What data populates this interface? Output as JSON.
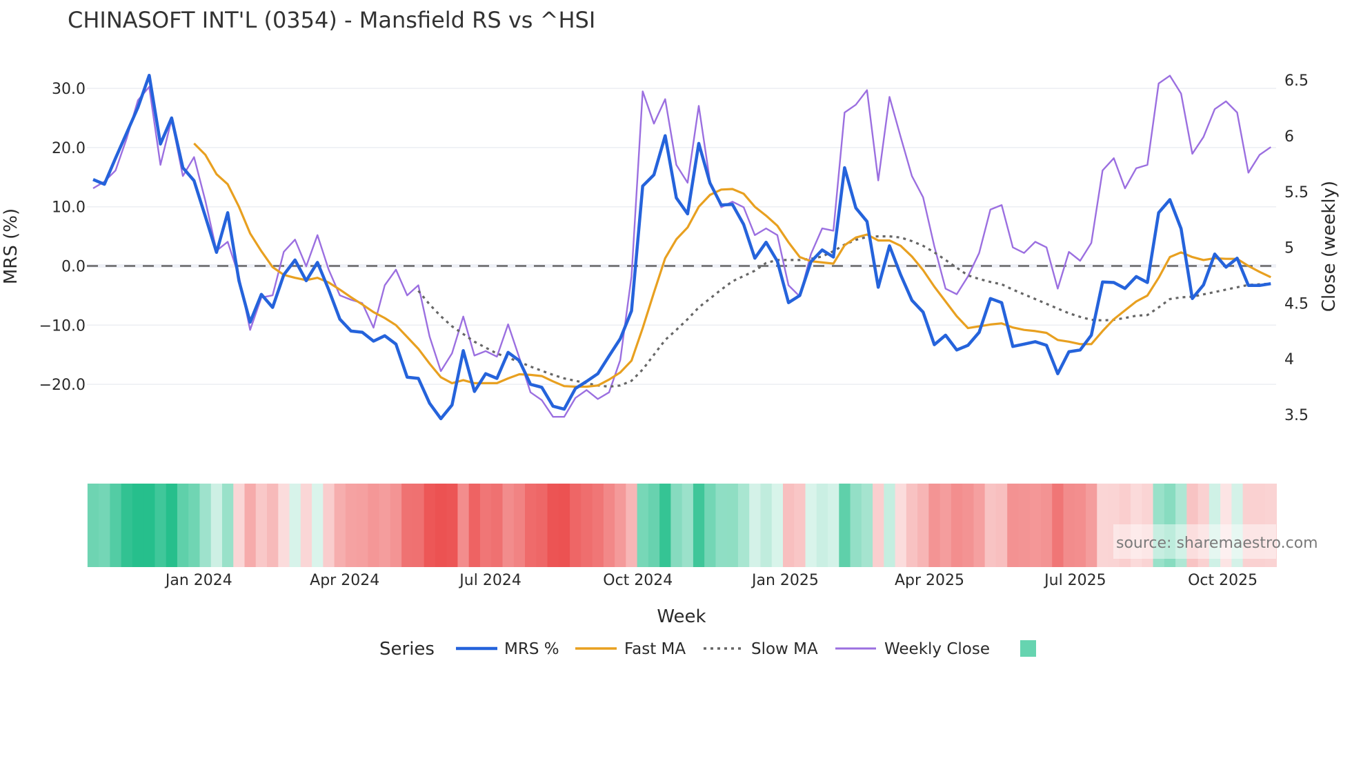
{
  "chart_data": {
    "type": "line",
    "title": "CHINASOFT INT'L (0354) - Mansfield RS vs ^HSI",
    "xlabel": "Week",
    "ylabel": "MRS (%)",
    "y2label": "Close (weekly)",
    "x_start": "2023-10-27",
    "x_step_days": 7,
    "ylim": [
      -27,
      33
    ],
    "y2lim": [
      3.5,
      6.5
    ],
    "yticks": [
      {
        "v": 30,
        "label": "30.0"
      },
      {
        "v": 20,
        "label": "20.0"
      },
      {
        "v": 10,
        "label": "10.0"
      },
      {
        "v": 0,
        "label": "0.0"
      },
      {
        "v": -10,
        "label": "−10.0"
      },
      {
        "v": -20,
        "label": "−20.0"
      }
    ],
    "y2ticks": [
      {
        "v": 6.5,
        "label": "6.5"
      },
      {
        "v": 6,
        "label": "6"
      },
      {
        "v": 5.5,
        "label": "5.5"
      },
      {
        "v": 5,
        "label": "5"
      },
      {
        "v": 4.5,
        "label": "4.5"
      },
      {
        "v": 4,
        "label": "4"
      },
      {
        "v": 3.5,
        "label": "3.5"
      }
    ],
    "xticks": [
      {
        "date": "2024-01-01",
        "label": "Jan 2024"
      },
      {
        "date": "2024-04-01",
        "label": "Apr 2024"
      },
      {
        "date": "2024-07-01",
        "label": "Jul 2024"
      },
      {
        "date": "2024-10-01",
        "label": "Oct 2024"
      },
      {
        "date": "2025-01-01",
        "label": "Jan 2025"
      },
      {
        "date": "2025-04-01",
        "label": "Apr 2025"
      },
      {
        "date": "2025-07-01",
        "label": "Jul 2025"
      },
      {
        "date": "2025-10-01",
        "label": "Oct 2025"
      }
    ],
    "zero_line": 0,
    "grid": true,
    "legend": {
      "title": "Series",
      "placement": "bottom"
    },
    "series": [
      {
        "name": "MRS %",
        "axis": "left",
        "color": "#2563db",
        "values": [
          14.6,
          13.8,
          18.2,
          22.5,
          26.8,
          32.2,
          20.6,
          25.0,
          16.6,
          14.4,
          8.4,
          2.3,
          9.0,
          -2.5,
          -9.5,
          -4.8,
          -7,
          -1.5,
          1.0,
          -2.5,
          0.6,
          -4,
          -9,
          -11,
          -11.2,
          -12.7,
          -11.8,
          -13.2,
          -18.8,
          -19,
          -23.2,
          -25.8,
          -23.5,
          -14.3,
          -21.2,
          -18.2,
          -19,
          -14.6,
          -16,
          -20,
          -20.5,
          -23.7,
          -24.2,
          -20.7,
          -19.5,
          -18.2,
          -15.2,
          -12.3,
          -7.6,
          13.5,
          15.4,
          22,
          11.5,
          8.8,
          20.7,
          14,
          10.3,
          10.4,
          7,
          1.3,
          4,
          0.8,
          -6.2,
          -5,
          0.7,
          2.7,
          1.5,
          16.6,
          9.8,
          7.5,
          -3.6,
          3.4,
          -1.5,
          -5.8,
          -7.8,
          -13.3,
          -11.7,
          -14.2,
          -13.4,
          -11.2,
          -5.5,
          -6.2,
          -13.6,
          -13.2,
          -12.8,
          -13.4,
          -18.2,
          -14.5,
          -14.2,
          -11.7,
          -2.7,
          -2.8,
          -3.8,
          -1.8,
          -2.8,
          9,
          11.2,
          6.3,
          -5.5,
          -3.2,
          2,
          -0.2,
          1.3,
          -3.3,
          -3.3,
          -3
        ]
      },
      {
        "name": "Fast MA",
        "axis": "left",
        "color": "#e8a020",
        "values": [
          null,
          null,
          null,
          null,
          null,
          null,
          null,
          null,
          null,
          20.7,
          18.8,
          15.5,
          13.8,
          10,
          5.5,
          2.5,
          -0.2,
          -1.5,
          -2,
          -2.4,
          -2,
          -2.8,
          -4,
          -5.3,
          -6.5,
          -7.8,
          -8.8,
          -10,
          -12,
          -14,
          -16.5,
          -18.8,
          -19.8,
          -19.3,
          -19.8,
          -19.8,
          -19.8,
          -19,
          -18.3,
          -18.4,
          -18.6,
          -19.5,
          -20.3,
          -20.4,
          -20.4,
          -20.2,
          -19.2,
          -18,
          -16,
          -10.5,
          -4.5,
          1.3,
          4.5,
          6.5,
          10,
          12,
          12.9,
          13,
          12.2,
          10,
          8.5,
          6.8,
          4,
          1.5,
          0.8,
          0.6,
          0.4,
          3.5,
          4.8,
          5.3,
          4.3,
          4.3,
          3.4,
          1.6,
          -0.7,
          -3.5,
          -6,
          -8.5,
          -10.5,
          -10.2,
          -9.9,
          -9.7,
          -10.4,
          -10.8,
          -11,
          -11.3,
          -12.5,
          -12.8,
          -13.2,
          -13.2,
          -11,
          -9,
          -7.5,
          -6,
          -5,
          -2,
          1.5,
          2.3,
          1.5,
          1.0,
          1.3,
          1.2,
          1.2,
          0,
          -1,
          -1.9
        ]
      },
      {
        "name": "Slow MA",
        "axis": "left",
        "color": "#666666",
        "dash": "dot",
        "values": [
          null,
          null,
          null,
          null,
          null,
          null,
          null,
          null,
          null,
          null,
          null,
          null,
          null,
          null,
          null,
          null,
          null,
          null,
          null,
          null,
          null,
          null,
          null,
          null,
          null,
          null,
          null,
          null,
          null,
          -4.2,
          -6.5,
          -8.5,
          -10.2,
          -11.5,
          -12.8,
          -13.8,
          -14.8,
          -15.5,
          -16.2,
          -17,
          -17.7,
          -18.4,
          -19,
          -19.4,
          -19.8,
          -20.2,
          -20.4,
          -20.2,
          -19.4,
          -17.5,
          -15,
          -12.5,
          -10.8,
          -9,
          -7,
          -5.5,
          -4,
          -2.6,
          -1.7,
          -0.8,
          0.5,
          1,
          1,
          1,
          1.2,
          1.6,
          2.5,
          3.6,
          4.4,
          4.9,
          5,
          5,
          4.8,
          4.2,
          3.4,
          2.3,
          1,
          -0.3,
          -1.6,
          -2.2,
          -2.7,
          -3.1,
          -4,
          -4.8,
          -5.6,
          -6.4,
          -7.2,
          -8,
          -8.6,
          -9.1,
          -9.2,
          -9.1,
          -8.8,
          -8.4,
          -8.3,
          -7,
          -5.6,
          -5.3,
          -5.2,
          -4.8,
          -4.4,
          -4,
          -3.6,
          -3.2,
          -3.1,
          -3
        ]
      },
      {
        "name": "Weekly Close",
        "axis": "right",
        "color": "#9b6fe0",
        "values": [
          5.53,
          5.59,
          5.69,
          5.98,
          6.32,
          6.44,
          5.74,
          6.15,
          5.64,
          5.81,
          5.42,
          4.97,
          5.05,
          4.74,
          4.26,
          4.55,
          4.57,
          4.96,
          5.07,
          4.83,
          5.11,
          4.8,
          4.57,
          4.53,
          4.5,
          4.28,
          4.66,
          4.8,
          4.57,
          4.66,
          4.2,
          3.89,
          4.05,
          4.38,
          4.03,
          4.07,
          4.02,
          4.31,
          4.01,
          3.7,
          3.63,
          3.48,
          3.48,
          3.65,
          3.72,
          3.64,
          3.7,
          3.99,
          4.74,
          6.4,
          6.11,
          6.33,
          5.74,
          5.58,
          6.27,
          5.59,
          5.36,
          5.41,
          5.36,
          5.11,
          5.17,
          5.11,
          4.66,
          4.56,
          4.94,
          5.17,
          5.15,
          6.21,
          6.28,
          6.41,
          5.6,
          6.35,
          5.99,
          5.64,
          5.45,
          5.01,
          4.63,
          4.58,
          4.74,
          4.95,
          5.34,
          5.38,
          5.0,
          4.95,
          5.05,
          5.0,
          4.63,
          4.96,
          4.88,
          5.04,
          5.69,
          5.8,
          5.53,
          5.71,
          5.74,
          6.47,
          6.54,
          6.38,
          5.84,
          5.99,
          6.24,
          6.31,
          6.21,
          5.67,
          5.83,
          5.9
        ]
      }
    ],
    "heatmap": {
      "source_series": "MRS %",
      "positive_color": "#26bf8c",
      "negative_color": "#ec5252",
      "legend_swatch_color": "#66d4b0"
    },
    "annotation": "source: sharemaestro.com"
  }
}
